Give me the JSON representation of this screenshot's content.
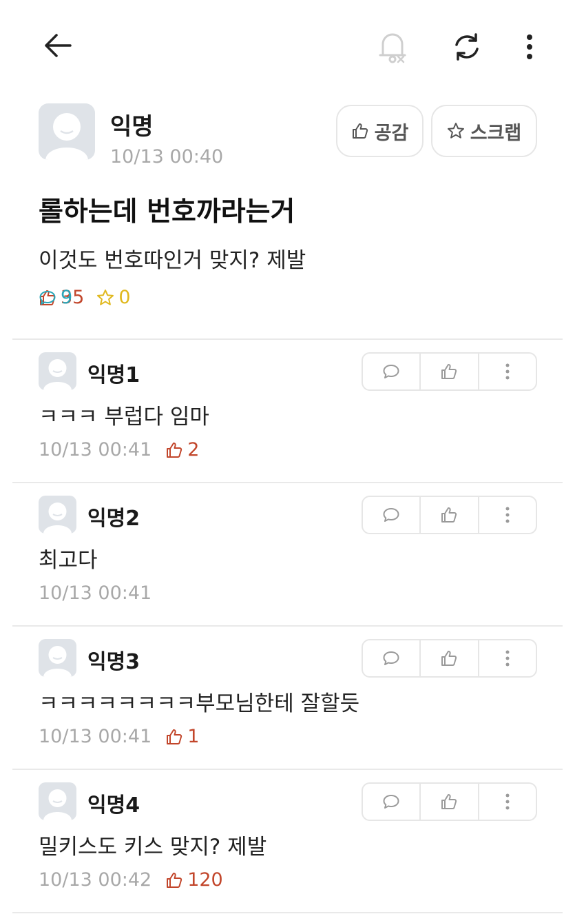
{
  "topbar": {
    "icons": [
      "back-arrow-icon",
      "bell-off-icon",
      "refresh-icon",
      "more-vertical-icon"
    ]
  },
  "post": {
    "author": "익명",
    "time": "10/13 00:40",
    "like_button": "공감",
    "scrap_button": "스크랩",
    "title": "롤하는데 번호까라는거",
    "body": "이것도 번호따인거 맞지? 제발",
    "likes": "35",
    "comments": "9",
    "scraps": "0",
    "colors": {
      "like": "#c2462b",
      "comment": "#2aa6b8",
      "scrap": "#e0b81d"
    }
  },
  "comments": [
    {
      "author": "익명1",
      "text": "ㅋㅋㅋ 부럽다 임마",
      "time": "10/13 00:41",
      "likes": "2"
    },
    {
      "author": "익명2",
      "text": "최고다",
      "time": "10/13 00:41",
      "likes": ""
    },
    {
      "author": "익명3",
      "text": "ㅋㅋㅋㅋㅋㅋㅋㅋ부모님한테 잘할듯",
      "time": "10/13 00:41",
      "likes": "1"
    },
    {
      "author": "익명4",
      "text": "밀키스도 키스 맞지? 제발",
      "time": "10/13 00:42",
      "likes": "120"
    }
  ]
}
